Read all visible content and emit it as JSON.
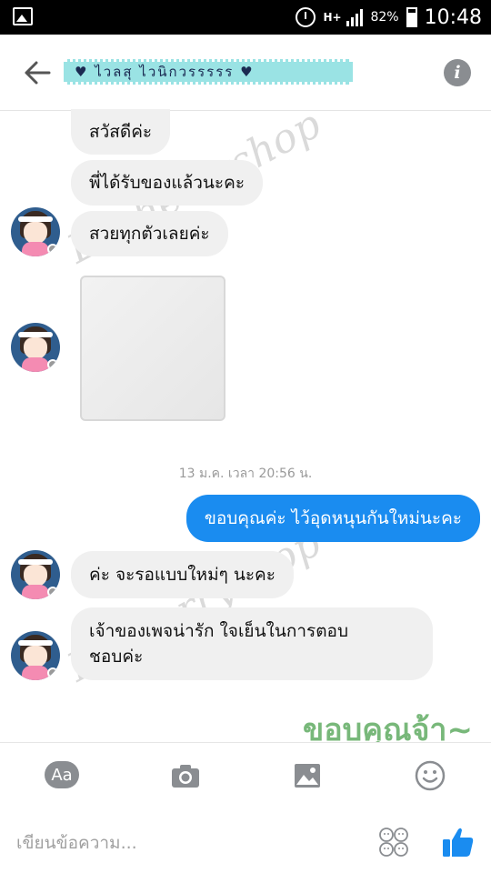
{
  "status_bar": {
    "network": "H+",
    "battery": "82%",
    "time": "10:48"
  },
  "header": {
    "title": "♥ ไวลสุ ไวนิกวรรรรร ♥"
  },
  "messages": [
    {
      "text": "สวัสดีค่ะ",
      "dir": "in"
    },
    {
      "text": "พี่ได้รับของแล้วนะคะ",
      "dir": "in"
    },
    {
      "text": "สวยทุกตัวเลยค่ะ",
      "dir": "in"
    },
    {
      "text": "",
      "dir": "in",
      "kind": "photo"
    },
    {
      "text": "ขอบคุณค่ะ ไว้อุดหนุนกันใหม่นะคะ",
      "dir": "out"
    },
    {
      "text": "ค่ะ จะรอแบบใหม่ๆ นะคะ",
      "dir": "in"
    },
    {
      "line1": "เจ้าของเพจน่ารัก ใจเย็นในการตอบ",
      "line2": "ชอบค่ะ",
      "dir": "in"
    }
  ],
  "timestamp": "13 ม.ค. เวลา 20:56 น.",
  "watermark": "Lacherryshop",
  "sticker_text": "ขอบคุณจ้า~",
  "toolbar": {
    "text_label": "Aa"
  },
  "composer": {
    "placeholder": "เขียนข้อความ..."
  }
}
